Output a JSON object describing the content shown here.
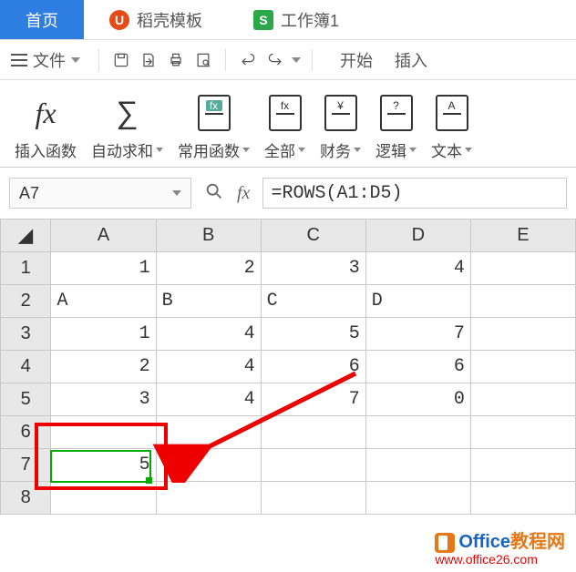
{
  "tabs": {
    "home": "首页",
    "docer_icon": "U",
    "docer": "稻壳模板",
    "book_icon": "S",
    "book": "工作簿1"
  },
  "qa": {
    "file": "文件",
    "start": "开始",
    "insert": "插入"
  },
  "ribbon": {
    "insert_fn": "插入函数",
    "autosum": "自动求和",
    "common": "常用函数",
    "all": "全部",
    "finance": "财务",
    "logic": "逻辑",
    "text": "文本",
    "icons": {
      "fx": "fx",
      "yen": "¥",
      "q": "?",
      "a": "A"
    }
  },
  "namebox": "A7",
  "formula": "=ROWS(A1:D5)",
  "cols": [
    "A",
    "B",
    "C",
    "D",
    "E"
  ],
  "rows": [
    "1",
    "2",
    "3",
    "4",
    "5",
    "6",
    "7",
    "8"
  ],
  "cells": {
    "r1": {
      "A": "1",
      "B": "2",
      "C": "3",
      "D": "4"
    },
    "r2": {
      "A": "A",
      "B": "B",
      "C": "C",
      "D": "D"
    },
    "r3": {
      "A": "1",
      "B": "4",
      "C": "5",
      "D": "7"
    },
    "r4": {
      "A": "2",
      "B": "4",
      "C": "6",
      "D": "6"
    },
    "r5": {
      "A": "3",
      "B": "4",
      "C": "7",
      "D": "0"
    },
    "r7": {
      "A": "5"
    }
  },
  "watermark": {
    "line1a": "Office",
    "line1b": "教程网",
    "line2": "www.office26.com"
  }
}
